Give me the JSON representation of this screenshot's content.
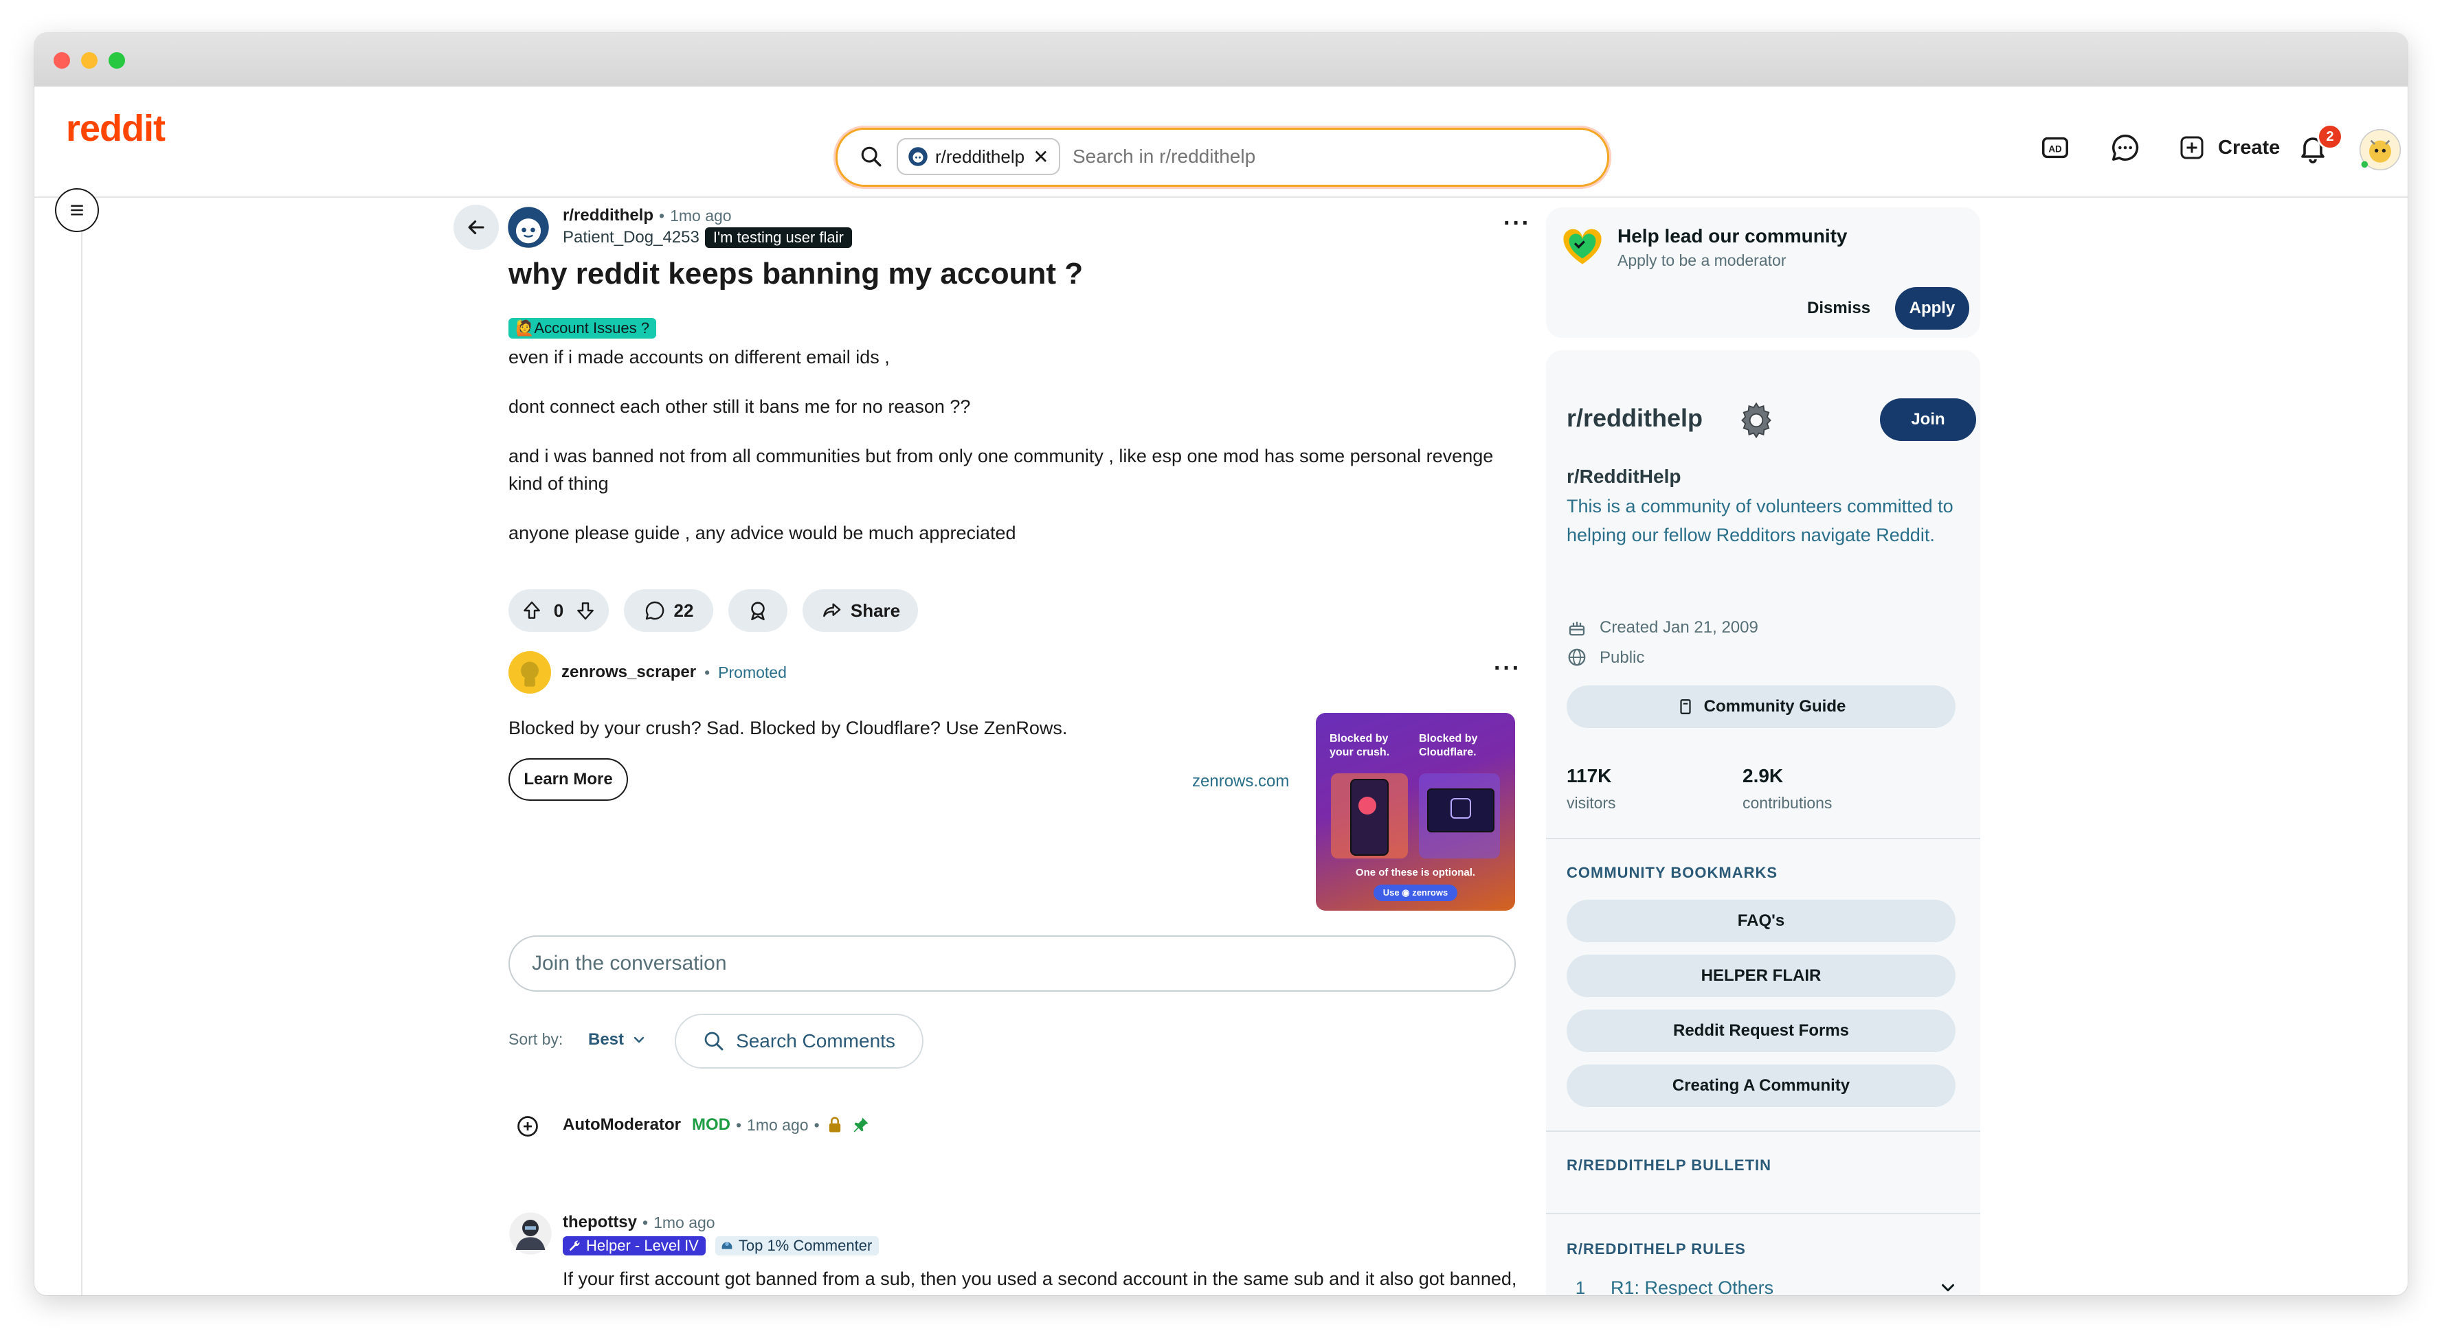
{
  "browser": {
    "dots": [
      "#ff5f57",
      "#febc2e",
      "#28c840"
    ]
  },
  "header": {
    "logo": "reddit",
    "search_chip": "r/reddithelp",
    "search_placeholder": "Search in r/reddithelp",
    "create_label": "Create",
    "notification_count": "2"
  },
  "post": {
    "subreddit": "r/reddithelp",
    "time": "1mo ago",
    "author": "Patient_Dog_4253",
    "user_flair": "I'm testing user flair",
    "title": "why reddit keeps banning my account ?",
    "post_flair": "🙋‍Account Issues ?",
    "paragraphs": [
      "even if i made accounts on different email ids ,",
      "dont connect each other still it bans me for no reason ??",
      "and i was banned not from all communities but from only one community , like esp one mod has some personal revenge kind of thing",
      "anyone please guide , any advice would be much appreciated"
    ],
    "votes": "0",
    "comments": "22",
    "share_label": "Share"
  },
  "ad": {
    "advertiser": "zenrows_scraper",
    "promoted": "Promoted",
    "text": "Blocked by your crush? Sad. Blocked by Cloudflare? Use ZenRows.",
    "cta": "Learn More",
    "domain": "zenrows.com",
    "image_text_left": "Blocked by your crush.",
    "image_text_right": "Blocked by Cloudflare.",
    "image_bottom": "One of these is optional.",
    "image_cta": "Use ◉ zenrows"
  },
  "comments_area": {
    "placeholder": "Join the conversation",
    "sort_label": "Sort by:",
    "sort_value": "Best",
    "search_label": "Search Comments"
  },
  "comments": [
    {
      "author": "AutoModerator",
      "badge": "MOD",
      "time": "1mo ago"
    },
    {
      "author": "thepottsy",
      "time": "1mo ago",
      "flair_level": "Helper - Level IV",
      "flair_top": "Top 1% Commenter",
      "text": "If your first account got banned from a sub, then you used a second account in the same sub and it also got banned, then they're using the ban evasion tool correctly."
    }
  ],
  "sidebar": {
    "mod_invite": {
      "title": "Help lead our community",
      "subtitle": "Apply to be a moderator",
      "dismiss": "Dismiss",
      "apply": "Apply"
    },
    "community": {
      "name": "r/reddithelp",
      "join": "Join",
      "display_name": "r/RedditHelp",
      "description": "This is a community of volunteers committed to helping our fellow Redditors navigate Reddit.",
      "created": "Created Jan 21, 2009",
      "visibility": "Public",
      "guide": "Community Guide",
      "visitors_value": "117K",
      "visitors_label": "visitors",
      "contributions_value": "2.9K",
      "contributions_label": "contributions"
    },
    "bookmarks_title": "COMMUNITY BOOKMARKS",
    "bookmarks": [
      "FAQ's",
      "HELPER FLAIR",
      "Reddit Request Forms",
      "Creating A Community"
    ],
    "bulletin_title": "R/REDDITHELP BULLETIN",
    "rules_title": "R/REDDITHELP RULES",
    "rules": [
      {
        "num": "1",
        "label": "R1: Respect Others"
      }
    ]
  }
}
